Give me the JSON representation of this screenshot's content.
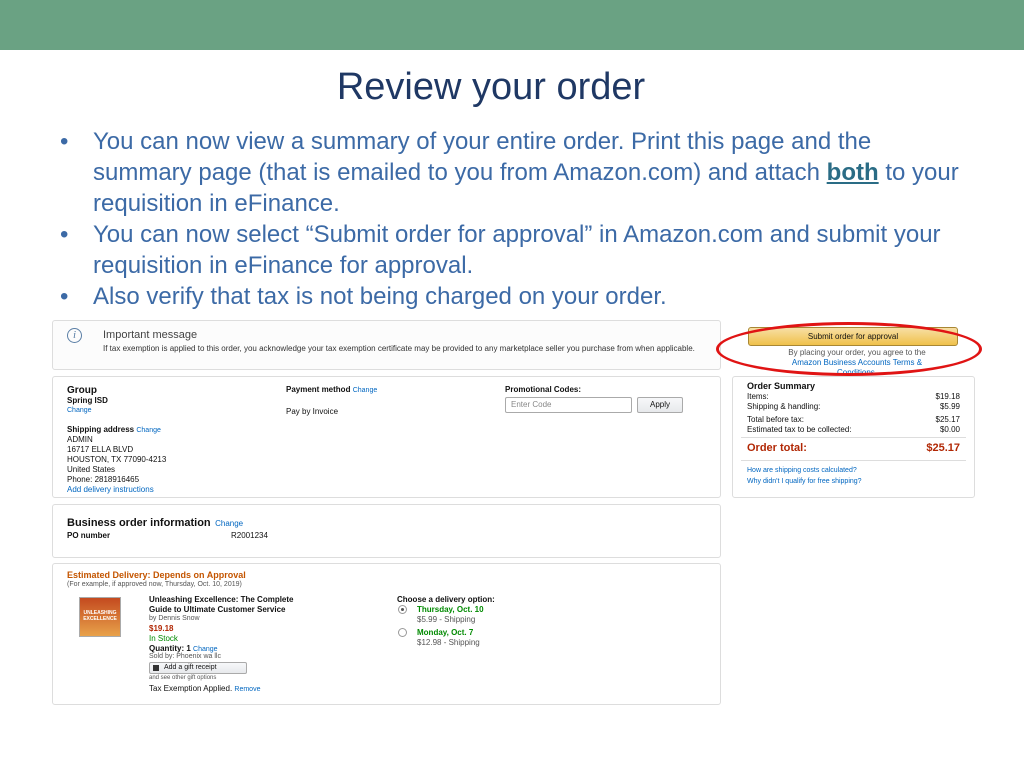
{
  "slide": {
    "title": "Review your order",
    "bullets": [
      {
        "pre": "You can now view a summary of your entire order.  Print this page and the summary page (that is emailed to you from Amazon.com) and attach ",
        "bold": "both",
        "post": " to your requisition in eFinance."
      },
      {
        "text": "You can now select “Submit order for approval” in Amazon.com and submit your requisition in eFinance for approval."
      },
      {
        "text": "Also verify that tax is not being charged on your order."
      }
    ]
  },
  "message": {
    "icon": "info-icon",
    "title": "Important message",
    "body": "If tax exemption is applied to this order, you acknowledge your tax exemption certificate may be provided to any marketplace seller you purchase from when applicable."
  },
  "group": {
    "label": "Group",
    "value": "Spring ISD",
    "change": "Change"
  },
  "shipping": {
    "label": "Shipping address",
    "change": "Change",
    "lines": [
      "ADMIN",
      "16717 ELLA BLVD",
      "HOUSTON, TX 77090-4213",
      "United States",
      "Phone: 2818916465"
    ],
    "instructions": "Add delivery instructions"
  },
  "payment": {
    "label": "Payment method",
    "change": "Change",
    "value": "Pay by Invoice"
  },
  "promo": {
    "label": "Promotional Codes:",
    "placeholder": "Enter Code",
    "apply": "Apply"
  },
  "business_info": {
    "title": "Business order information",
    "change": "Change",
    "po_label": "PO number",
    "po_value": "R2001234"
  },
  "delivery": {
    "estimated": "Estimated Delivery: Depends on Approval",
    "example": "(For example, if approved now, Thursday, Oct. 10, 2019)",
    "item": {
      "title_line1": "Unleashing Excellence: The Complete",
      "title_line2": "Guide to Ultimate Customer Service",
      "author": "by Dennis Snow",
      "price": "$19.18",
      "stock": "In Stock",
      "quantity": "Quantity: 1",
      "quantity_change": "Change",
      "sold_by": "Sold by: Phoenix wa llc",
      "gift": "Add a gift receipt",
      "gift_options": "and see other gift options",
      "tax": "Tax Exemption Applied.",
      "remove": "Remove",
      "cover_text": "UNLEASHING EXCELLENCE"
    },
    "choose_label": "Choose a delivery option:",
    "options": [
      {
        "date": "Thursday, Oct. 10",
        "price": "$5.99 - Shipping",
        "selected": true
      },
      {
        "date": "Monday, Oct. 7",
        "price": "$12.98 - Shipping",
        "selected": false
      }
    ]
  },
  "summary": {
    "submit": "Submit order for approval",
    "agree_line1": "By placing your order, you agree to the",
    "agree_line2": "Amazon Business Accounts Terms &",
    "agree_line3": "Conditions.",
    "title": "Order Summary",
    "rows": [
      {
        "label": "Items:",
        "value": "$19.18"
      },
      {
        "label": "Shipping & handling:",
        "value": "$5.99"
      },
      {
        "label": "Total before tax:",
        "value": "$25.17"
      },
      {
        "label": "Estimated tax to be collected:",
        "value": "$0.00"
      }
    ],
    "total_label": "Order total:",
    "total_value": "$25.17",
    "link1": "How are shipping costs calculated?",
    "link2": "Why didn't I qualify for free shipping?"
  },
  "colors": {
    "header_bar": "#6aa283",
    "highlight": "#e01414",
    "accent_orange": "#c45500",
    "green": "#008a00",
    "price_red": "#b12704"
  }
}
